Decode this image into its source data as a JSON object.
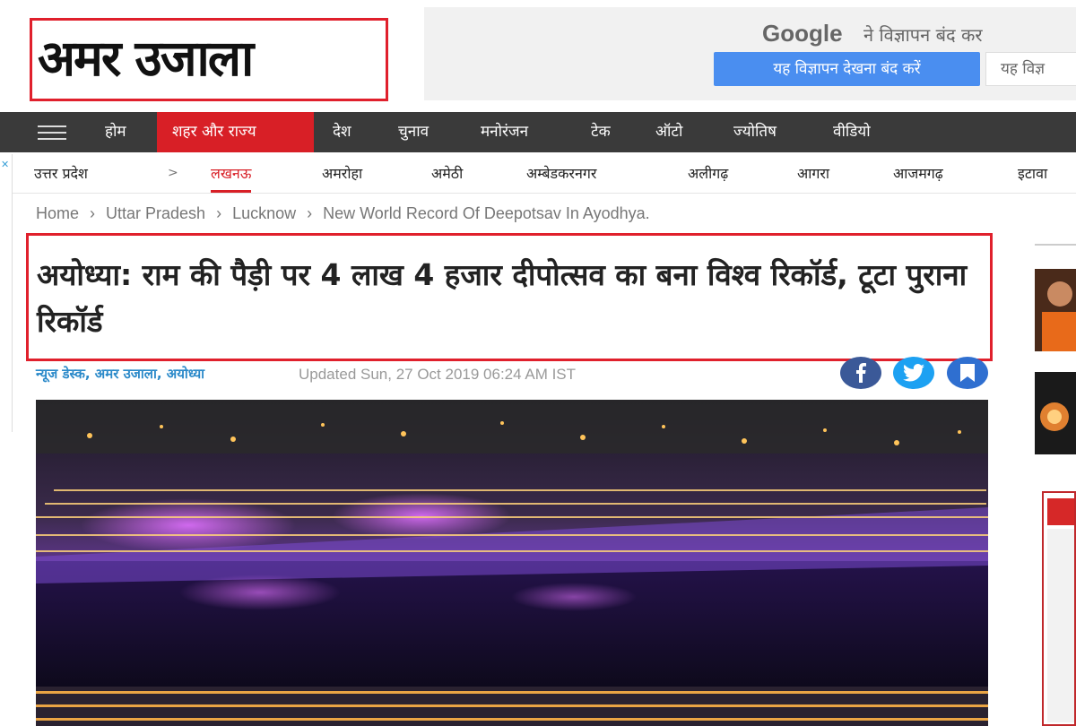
{
  "header": {
    "logo_text": "अमर उजाला"
  },
  "ad": {
    "google": "Google",
    "text": "ने विज्ञापन बंद कर",
    "stop_button": "यह विज्ञापन देखना बंद करें",
    "why_button": "यह विज्ञ"
  },
  "main_nav": {
    "items": [
      "होम",
      "शहर और राज्य",
      "देश",
      "चुनाव",
      "मनोरंजन",
      "टेक",
      "ऑटो",
      "ज्योतिष",
      "वीडियो"
    ],
    "active": "शहर और राज्य"
  },
  "sub_nav": {
    "state": "उत्तर प्रदेश",
    "arrow": ">",
    "items": [
      "लखनऊ",
      "अमरोहा",
      "अमेठी",
      "अम्बेडकरनगर",
      "अलीगढ़",
      "आगरा",
      "आजमगढ़",
      "इटावा"
    ],
    "active": "लखनऊ"
  },
  "breadcrumb": {
    "items": [
      "Home",
      "Uttar Pradesh",
      "Lucknow",
      "New World Record Of Deepotsav In Ayodhya."
    ],
    "separator": "›"
  },
  "article": {
    "headline": "अयोध्या: राम की पैड़ी पर 4 लाख 4 हजार दीपोत्सव का बना विश्व रिकॉर्ड, टूटा पुराना रिकॉर्ड",
    "byline": "न्यूज डेस्क, अमर उजाला, अयोध्या",
    "updated": "Updated Sun, 27 Oct 2019 06:24 AM IST"
  },
  "share": [
    {
      "icon": "facebook-icon",
      "color": "#3b5998"
    },
    {
      "icon": "twitter-icon",
      "color": "#1da1f2"
    },
    {
      "icon": "bookmark-icon",
      "color": "#2f6fd0"
    }
  ],
  "colors": {
    "accent": "#d81f26",
    "nav_bg": "#3a3a3a",
    "byline": "#2a89c9"
  }
}
